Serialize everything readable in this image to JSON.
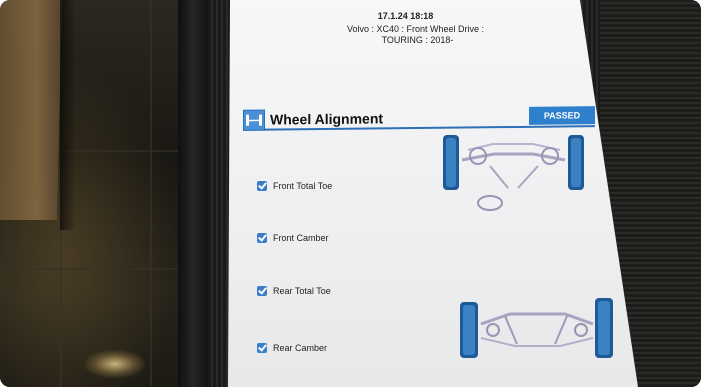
{
  "report": {
    "datetime": "17.1.24 18:18",
    "vehicle_line1": "Volvo : XC40 : Front Wheel Drive :",
    "vehicle_line2": "TOURING : 2018-"
  },
  "section": {
    "icon": "wheel-alignment-icon",
    "title": "Wheel Alignment",
    "status": "PASSED",
    "accent_color": "#2f80cc"
  },
  "checks": [
    {
      "label": "Front Total Toe",
      "checked": true
    },
    {
      "label": "Front Camber",
      "checked": true
    },
    {
      "label": "Rear Total Toe",
      "checked": true
    },
    {
      "label": "Rear Camber",
      "checked": true
    }
  ],
  "diagrams": {
    "front": "front-axle-icon",
    "rear": "rear-axle-icon"
  }
}
